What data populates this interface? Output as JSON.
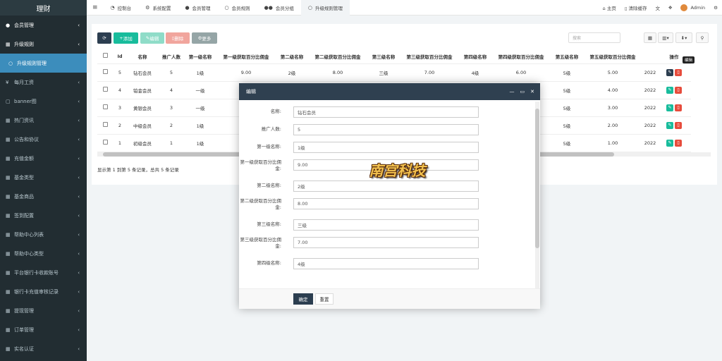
{
  "app": {
    "title": "理财"
  },
  "sidebar": {
    "items": [
      {
        "label": "会员管理",
        "icon": "user-icon",
        "bold": true
      },
      {
        "label": "升级规则",
        "icon": "list-icon",
        "bold": true
      },
      {
        "label": "升级规则管理",
        "icon": "circle-icon",
        "active": true
      },
      {
        "label": "每月工资",
        "icon": "yen-icon"
      },
      {
        "label": "banner图",
        "icon": "image-icon"
      },
      {
        "label": "热门资讯",
        "icon": "list-icon"
      },
      {
        "label": "公告和协议",
        "icon": "list-icon"
      },
      {
        "label": "充值金额",
        "icon": "list-icon"
      },
      {
        "label": "基金类型",
        "icon": "list-icon"
      },
      {
        "label": "基金商品",
        "icon": "list-icon"
      },
      {
        "label": "签到配置",
        "icon": "list-icon"
      },
      {
        "label": "帮助中心列表",
        "icon": "list-icon"
      },
      {
        "label": "帮助中心类型",
        "icon": "list-icon"
      },
      {
        "label": "平台银行卡收款账号",
        "icon": "list-icon"
      },
      {
        "label": "银行卡充值审核记录",
        "icon": "list-icon"
      },
      {
        "label": "提现管理",
        "icon": "list-icon"
      },
      {
        "label": "订单管理",
        "icon": "list-icon"
      },
      {
        "label": "实名认证",
        "icon": "list-icon"
      }
    ]
  },
  "topbar": {
    "tabs": [
      {
        "label": "控制台",
        "icon": "dashboard-icon"
      },
      {
        "label": "系统配置",
        "icon": "gear-icon"
      },
      {
        "label": "会员管理",
        "icon": "user-icon"
      },
      {
        "label": "会员规则",
        "icon": "circle-icon"
      },
      {
        "label": "会员分组",
        "icon": "users-icon"
      },
      {
        "label": "升级规则管理",
        "icon": "circle-icon",
        "active": true
      }
    ],
    "home": "主页",
    "clear_cache": "清除缓存",
    "user": "Admin"
  },
  "toolbar": {
    "add": "添加",
    "edit": "编辑",
    "delete": "删除",
    "more": "更多",
    "search_placeholder": "搜索"
  },
  "table": {
    "headers": [
      "Id",
      "名称",
      "推广人数",
      "第一级名称",
      "第一级获取百分比佣金",
      "第二级名称",
      "第二级获取百分比佣金",
      "第三级名称",
      "第三级获取百分比佣金",
      "第四级名称",
      "第四级获取百分比佣金",
      "第五级名称",
      "第五级获取百分比佣金",
      "",
      "操作"
    ],
    "rows": [
      [
        "5",
        "钻石会员",
        "5",
        "1级",
        "9.00",
        "2级",
        "8.00",
        "三级",
        "7.00",
        "4级",
        "6.00",
        "5级",
        "5.00",
        "2022"
      ],
      [
        "4",
        "铂金会员",
        "4",
        "一级",
        "",
        "",
        "",
        "",
        "",
        "",
        ".00",
        "5级",
        "4.00",
        "2022"
      ],
      [
        "3",
        "黄银会员",
        "3",
        "一级",
        "",
        "",
        "",
        "",
        "",
        "",
        ".00",
        "5级",
        "3.00",
        "2022"
      ],
      [
        "2",
        "中级会员",
        "2",
        "1级",
        "",
        "",
        "",
        "",
        "",
        "",
        ".00",
        "5级",
        "2.00",
        "2022"
      ],
      [
        "1",
        "初级会员",
        "1",
        "1级",
        "",
        "",
        "",
        "",
        "",
        "",
        ".00",
        "5级",
        "1.00",
        "2022"
      ]
    ],
    "tooltip": "编辑"
  },
  "pagination": {
    "info": "显示第 1 到第 5 条记录，总共 5 条记录"
  },
  "modal": {
    "title": "编辑",
    "fields": [
      {
        "label": "名称:",
        "value": "钻石会员"
      },
      {
        "label": "推广人数:",
        "value": "5"
      },
      {
        "label": "第一级名称:",
        "value": "1级"
      },
      {
        "label": "第一级获取百分比佣金:",
        "value": "9.00"
      },
      {
        "label": "第二级名称:",
        "value": "2级"
      },
      {
        "label": "第二级获取百分比佣金:",
        "value": "8.00"
      },
      {
        "label": "第三级名称:",
        "value": "三级"
      },
      {
        "label": "第三级获取百分比佣金:",
        "value": "7.00"
      },
      {
        "label": "第四级名称:",
        "value": "4级"
      }
    ],
    "confirm": "确定",
    "reset": "重置"
  },
  "watermark": {
    "text": "南宫科技"
  },
  "colors": {
    "sidebar": "#222d32",
    "active": "#3c8dbc",
    "green": "#18bc9c",
    "red": "#e74c3c",
    "dark": "#2c3e50",
    "modal_head": "#2f4050"
  }
}
